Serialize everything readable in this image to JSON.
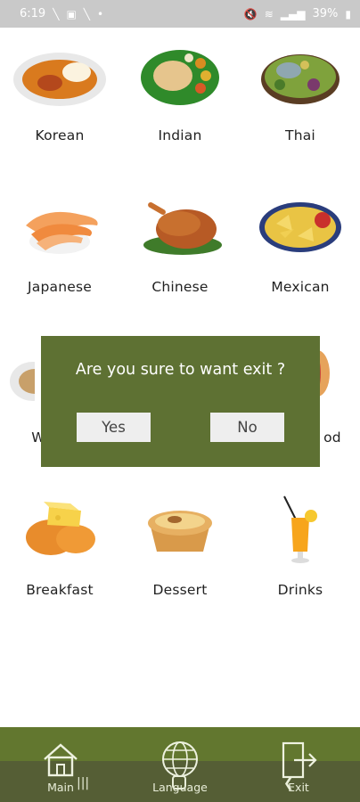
{
  "status_bar": {
    "time": "6:19",
    "battery": "39%"
  },
  "categories": [
    {
      "label": "Korean"
    },
    {
      "label": "Indian"
    },
    {
      "label": "Thai"
    },
    {
      "label": "Japanese"
    },
    {
      "label": "Chinese"
    },
    {
      "label": "Mexican"
    },
    {
      "label": "W"
    },
    {
      "label": "od"
    },
    {
      "label": "Breakfast"
    },
    {
      "label": "Dessert"
    },
    {
      "label": "Drinks"
    }
  ],
  "dialog": {
    "title": "Are you sure to want exit ?",
    "yes_label": "Yes",
    "no_label": "No"
  },
  "bottom_nav": {
    "items": [
      {
        "label": "Main",
        "icon": "home-icon"
      },
      {
        "label": "Language",
        "icon": "globe-icon"
      },
      {
        "label": "Exit",
        "icon": "exit-icon"
      }
    ]
  },
  "colors": {
    "accent": "#62772f",
    "dialog": "#5e7133",
    "status_bar": "#c9c9c9"
  }
}
